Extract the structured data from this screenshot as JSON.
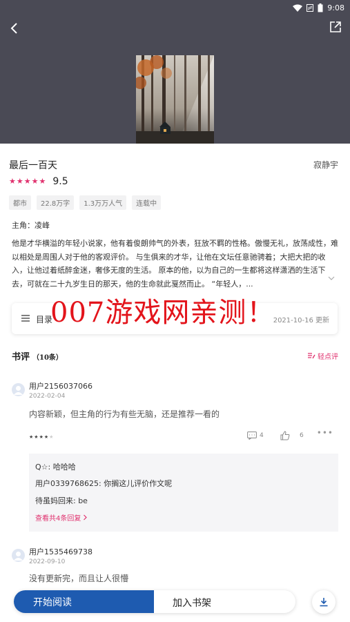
{
  "status_bar": {
    "time": "9:08"
  },
  "book": {
    "title": "最后一百天",
    "author": "寂静宇",
    "rating_stars": 5,
    "score": "9.5",
    "tags": [
      "都市",
      "22.8万字",
      "1.3万万人气",
      "连载中"
    ],
    "protagonist": "主角：凌峰",
    "description": "他是才华横溢的年轻小说家，他有着俊朗帅气的外表，狂放不羁的性格。傲慢无礼，放荡成性，难以相处是周围人对于他的客观评价。 与生俱来的才华，让他在文坛任意驰骋着；大把大把的收入，让他过着纸醉金迷，奢侈无度的生活。 原本的他，以为自己的一生都将这样潇洒的生活下去，可就在二十九岁生日的那天，他的生命就此戛然而止。 “年轻人，..."
  },
  "toc": {
    "label": "目录",
    "date": "2021-10-16 更新"
  },
  "watermark": "007游戏网亲测！",
  "reviews": {
    "title": "书评",
    "count": "（10条）",
    "write_label": "轻点评",
    "items": [
      {
        "user": "用户2156037066",
        "date": "2022-02-04",
        "text": "内容新颖，但主角的行为有些无脑，还是推荐一看的",
        "stars": 4,
        "comments": "4",
        "likes": "6",
        "replies": [
          "Q☆: 哈哈哈",
          "用户0339768625: 你搁这儿评价作文呢",
          "待虽妈回来: be"
        ],
        "view_replies": "查看共4条回复"
      },
      {
        "user": "用户1535469738",
        "date": "2022-09-10",
        "text": "没有更新完，而且让人很懵"
      }
    ]
  },
  "bottom": {
    "start_read": "开始阅读",
    "add_shelf": "加入书架"
  },
  "colors": {
    "accent": "#e0316e",
    "primary": "#1e5bb0",
    "header_bg": "#4a4a55",
    "watermark": "#e3141b"
  }
}
